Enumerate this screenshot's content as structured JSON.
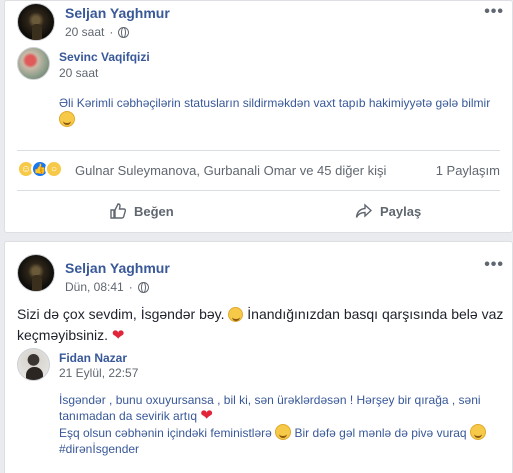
{
  "post1": {
    "author": "Seljan Yaghmur",
    "time": "20 saat",
    "menu": "•••",
    "shared": {
      "author": "Sevinc Vaqifqizi",
      "time": "20 saat",
      "text": "Əli Kərimli cəbhəçilərin statusların sildirməkdən vaxt tapıb hakimiyyətə gələ bilmir"
    },
    "reaction_names": "Gulnar Suleymanova, Gurbanali Omar ve 45 diğer kişi",
    "shares": "1 Paylaşım",
    "like_label": "Beğen",
    "share_label": "Paylaş"
  },
  "post2": {
    "author": "Seljan Yaghmur",
    "time": "Dün, 08:41",
    "menu": "•••",
    "text_part1": "Sizi də çox sevdim, İsgəndər bəy.",
    "text_part2": "İnandığınızdan basqı qarşısında belə vaz",
    "text_line2": "keçməyibsiniz.",
    "shared": {
      "author": "Fidan Nazar",
      "time": "21 Eylül, 22:57",
      "line1": "İsgəndər , bunu oxuyursansa , bil ki, sən ürəklərdəsən ! Hərşey bir qırağa , səni",
      "line2": "tanımadan da sevirik artıq",
      "line3a": "Eşq olsun cəbhənin içindəki feministlərə",
      "line3b": "Bir dəfə gəl mənlə də pivə vuraq",
      "line4": "#dirənİsgender"
    }
  }
}
